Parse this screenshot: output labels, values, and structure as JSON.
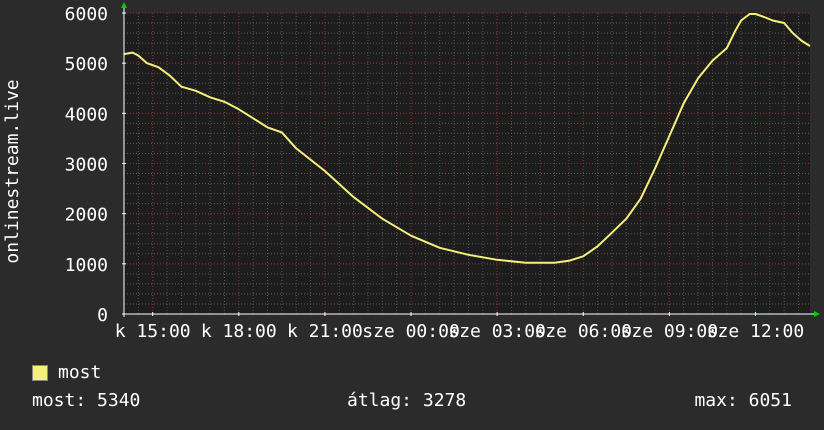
{
  "colors": {
    "background": "#2b2b2b",
    "plot_background": "#1d1d1d",
    "grid_major": "#8a2a2a",
    "grid_minor": "#555555",
    "line": "#f5f07a",
    "axis": "#ffffff",
    "axis_arrow": "#00cc00",
    "swatch": "#f5f07a"
  },
  "legend": {
    "label": "most"
  },
  "stats": {
    "now": "most: 5340",
    "avg": "átlag: 3278",
    "max": "max: 6051"
  },
  "chart_data": {
    "type": "line",
    "ylabel": "onlinestream.live",
    "xlabel": "",
    "ylim": [
      0,
      6000
    ],
    "yticks": [
      0,
      1000,
      2000,
      3000,
      4000,
      5000,
      6000
    ],
    "ytick_labels": [
      "0",
      "1000",
      "2000",
      "3000",
      "4000",
      "5000",
      "6000"
    ],
    "xlim": [
      14.0,
      37.9
    ],
    "xticks": [
      15,
      18,
      21,
      24,
      27,
      30,
      33,
      36
    ],
    "xtick_labels": [
      "k 15:00",
      "k 18:00",
      "k 21:00",
      "sze 00:00",
      "sze 03:00",
      "sze 06:00",
      "sze 09:00",
      "sze 12:00"
    ],
    "grid": true,
    "series": [
      {
        "name": "most",
        "x": [
          14.0,
          14.3,
          14.5,
          14.8,
          15.2,
          15.6,
          16.0,
          16.5,
          17.0,
          17.5,
          18.0,
          18.5,
          19.0,
          19.5,
          20.0,
          21.0,
          22.0,
          23.0,
          24.0,
          25.0,
          26.0,
          27.0,
          28.0,
          29.0,
          29.5,
          30.0,
          30.5,
          31.0,
          31.5,
          32.0,
          32.5,
          33.0,
          33.5,
          34.0,
          34.5,
          35.0,
          35.3,
          35.5,
          35.8,
          36.0,
          36.3,
          36.6,
          37.0,
          37.3,
          37.6,
          37.9
        ],
        "y": [
          5180,
          5210,
          5150,
          5000,
          4920,
          4750,
          4530,
          4450,
          4320,
          4230,
          4080,
          3900,
          3720,
          3620,
          3300,
          2850,
          2330,
          1900,
          1560,
          1320,
          1180,
          1080,
          1020,
          1020,
          1060,
          1150,
          1350,
          1620,
          1900,
          2300,
          2900,
          3550,
          4200,
          4700,
          5050,
          5300,
          5650,
          5850,
          5980,
          5980,
          5920,
          5850,
          5800,
          5600,
          5450,
          5340
        ]
      }
    ]
  }
}
